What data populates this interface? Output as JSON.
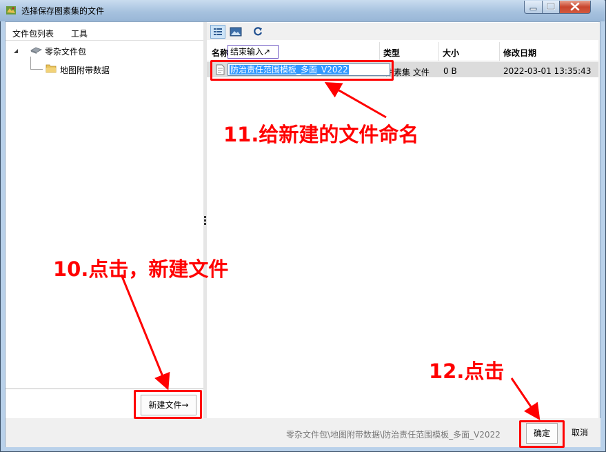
{
  "window": {
    "title": "选择保存图素集的文件"
  },
  "left_pane": {
    "menu": [
      "文件包列表",
      "工具"
    ],
    "tree": {
      "root_label": "零杂文件包",
      "child_label": "地图附带数据"
    },
    "new_file_button": "新建文件→"
  },
  "right_pane": {
    "columns": [
      "名称",
      "类型",
      "大小",
      "修改日期"
    ],
    "row": {
      "name": "防治责任范围模板_多面_V2022",
      "type": "图素集 文件",
      "size": "0 B",
      "modified": "2022-03-01 13:35:43"
    },
    "ime_tooltip": "结束输入↗"
  },
  "status": {
    "path": "零杂文件包\\地图附带数据\\防治责任范围模板_多面_V2022",
    "ok_label": "确定",
    "cancel_label": "取消"
  },
  "annotations": {
    "step10": "10.点击，新建文件",
    "step11": "11.给新建的文件命名",
    "step12": "12.点击"
  },
  "colors": {
    "annotation": "#ff0000",
    "selection": "#3399ff",
    "titlebar": "#a7c2df"
  },
  "icons": [
    "app-icon",
    "minimize-icon",
    "maximize-icon",
    "close-icon",
    "expand-triangle-icon",
    "package-icon",
    "folder-icon",
    "details-view-icon",
    "image-view-icon",
    "refresh-icon",
    "file-icon"
  ]
}
